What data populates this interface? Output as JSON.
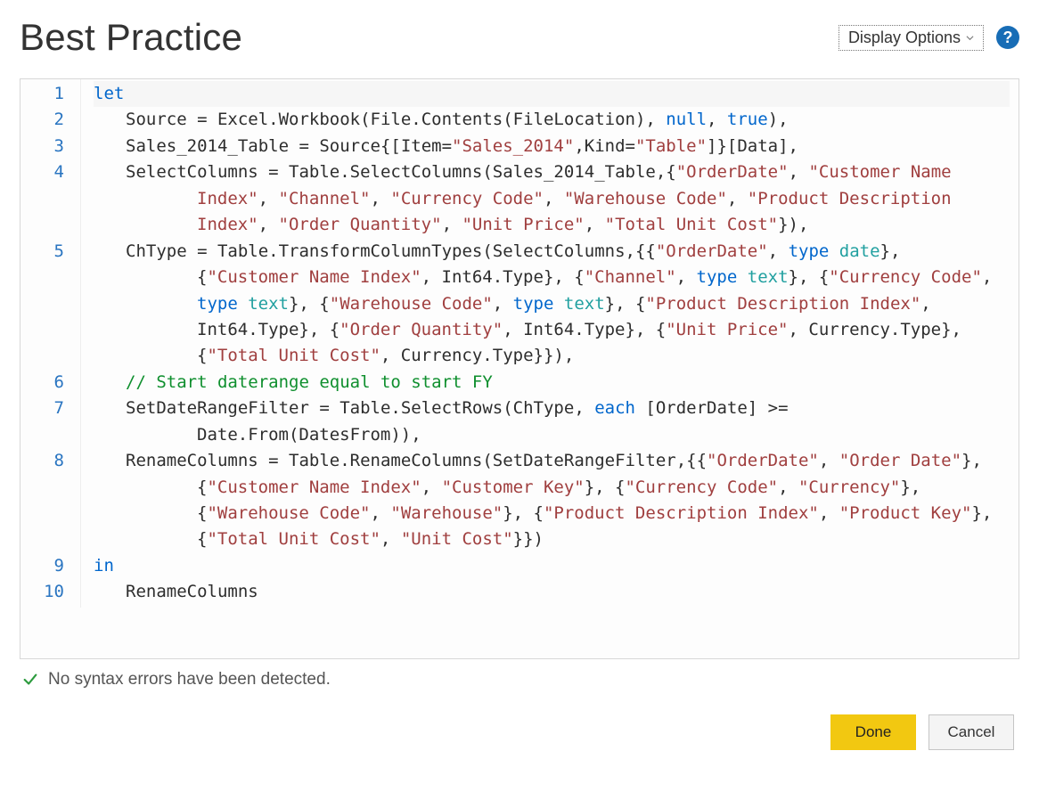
{
  "header": {
    "title": "Best Practice",
    "display_options_label": "Display Options",
    "help_tooltip": "?"
  },
  "editor": {
    "lines": [
      {
        "n": 1,
        "segments": [
          {
            "t": "let",
            "c": "kw"
          }
        ]
      },
      {
        "n": 2,
        "indent": 1,
        "segments": [
          {
            "t": "Source = Excel.Workbook(File.Contents(FileLocation), "
          },
          {
            "t": "null",
            "c": "kw"
          },
          {
            "t": ", "
          },
          {
            "t": "true",
            "c": "kw"
          },
          {
            "t": "),"
          }
        ]
      },
      {
        "n": 3,
        "indent": 1,
        "segments": [
          {
            "t": "Sales_2014_Table = Source{[Item="
          },
          {
            "t": "\"Sales_2014\"",
            "c": "str"
          },
          {
            "t": ",Kind="
          },
          {
            "t": "\"Table\"",
            "c": "str"
          },
          {
            "t": "]}[Data],"
          }
        ]
      },
      {
        "n": 4,
        "indent": 1,
        "wrap": true,
        "segments": [
          {
            "t": "SelectColumns = Table.SelectColumns(Sales_2014_Table,{"
          },
          {
            "t": "\"OrderDate\"",
            "c": "str"
          },
          {
            "t": ", "
          },
          {
            "t": "\"Customer Name Index\"",
            "c": "str"
          },
          {
            "t": ", "
          },
          {
            "t": "\"Channel\"",
            "c": "str"
          },
          {
            "t": ", "
          },
          {
            "t": "\"Currency Code\"",
            "c": "str"
          },
          {
            "t": ", "
          },
          {
            "t": "\"Warehouse Code\"",
            "c": "str"
          },
          {
            "t": ", "
          },
          {
            "t": "\"Product Description Index\"",
            "c": "str"
          },
          {
            "t": ", "
          },
          {
            "t": "\"Order Quantity\"",
            "c": "str"
          },
          {
            "t": ", "
          },
          {
            "t": "\"Unit Price\"",
            "c": "str"
          },
          {
            "t": ", "
          },
          {
            "t": "\"Total Unit Cost\"",
            "c": "str"
          },
          {
            "t": "}),"
          }
        ]
      },
      {
        "n": 5,
        "indent": 1,
        "wrap": true,
        "segments": [
          {
            "t": "ChType = Table.TransformColumnTypes(SelectColumns,{{"
          },
          {
            "t": "\"OrderDate\"",
            "c": "str"
          },
          {
            "t": ", "
          },
          {
            "t": "type",
            "c": "kw"
          },
          {
            "t": " "
          },
          {
            "t": "date",
            "c": "type"
          },
          {
            "t": "}, {"
          },
          {
            "t": "\"Customer Name Index\"",
            "c": "str"
          },
          {
            "t": ", Int64.Type}, {"
          },
          {
            "t": "\"Channel\"",
            "c": "str"
          },
          {
            "t": ", "
          },
          {
            "t": "type",
            "c": "kw"
          },
          {
            "t": " "
          },
          {
            "t": "text",
            "c": "type"
          },
          {
            "t": "}, {"
          },
          {
            "t": "\"Currency Code\"",
            "c": "str"
          },
          {
            "t": ", "
          },
          {
            "t": "type",
            "c": "kw"
          },
          {
            "t": " "
          },
          {
            "t": "text",
            "c": "type"
          },
          {
            "t": "}, {"
          },
          {
            "t": "\"Warehouse Code\"",
            "c": "str"
          },
          {
            "t": ", "
          },
          {
            "t": "type",
            "c": "kw"
          },
          {
            "t": " "
          },
          {
            "t": "text",
            "c": "type"
          },
          {
            "t": "}, {"
          },
          {
            "t": "\"Product Description Index\"",
            "c": "str"
          },
          {
            "t": ", Int64.Type}, {"
          },
          {
            "t": "\"Order Quantity\"",
            "c": "str"
          },
          {
            "t": ", Int64.Type}, {"
          },
          {
            "t": "\"Unit Price\"",
            "c": "str"
          },
          {
            "t": ", Currency.Type}, {"
          },
          {
            "t": "\"Total Unit Cost\"",
            "c": "str"
          },
          {
            "t": ", Currency.Type}}),"
          }
        ]
      },
      {
        "n": 6,
        "indent": 1,
        "segments": [
          {
            "t": "// Start daterange equal to start FY",
            "c": "cmt"
          }
        ]
      },
      {
        "n": 7,
        "indent": 1,
        "wrap": true,
        "segments": [
          {
            "t": "SetDateRangeFilter = Table.SelectRows(ChType, "
          },
          {
            "t": "each",
            "c": "kw"
          },
          {
            "t": " [OrderDate] >= Date.From(DatesFrom)),"
          }
        ]
      },
      {
        "n": 8,
        "indent": 1,
        "wrap": true,
        "segments": [
          {
            "t": "RenameColumns = Table.RenameColumns(SetDateRangeFilter,{{"
          },
          {
            "t": "\"OrderDate\"",
            "c": "str"
          },
          {
            "t": ", "
          },
          {
            "t": "\"Order Date\"",
            "c": "str"
          },
          {
            "t": "}, {"
          },
          {
            "t": "\"Customer Name Index\"",
            "c": "str"
          },
          {
            "t": ", "
          },
          {
            "t": "\"Customer Key\"",
            "c": "str"
          },
          {
            "t": "}, {"
          },
          {
            "t": "\"Currency Code\"",
            "c": "str"
          },
          {
            "t": ", "
          },
          {
            "t": "\"Currency\"",
            "c": "str"
          },
          {
            "t": "}, {"
          },
          {
            "t": "\"Warehouse Code\"",
            "c": "str"
          },
          {
            "t": ", "
          },
          {
            "t": "\"Warehouse\"",
            "c": "str"
          },
          {
            "t": "}, {"
          },
          {
            "t": "\"Product Description Index\"",
            "c": "str"
          },
          {
            "t": ", "
          },
          {
            "t": "\"Product Key\"",
            "c": "str"
          },
          {
            "t": "}, {"
          },
          {
            "t": "\"Total Unit Cost\"",
            "c": "str"
          },
          {
            "t": ", "
          },
          {
            "t": "\"Unit Cost\"",
            "c": "str"
          },
          {
            "t": "}})"
          }
        ]
      },
      {
        "n": 9,
        "segments": [
          {
            "t": "in",
            "c": "kw"
          }
        ]
      },
      {
        "n": 10,
        "indent": 1,
        "segments": [
          {
            "t": "RenameColumns"
          }
        ]
      }
    ]
  },
  "status": {
    "message": "No syntax errors have been detected."
  },
  "buttons": {
    "done": "Done",
    "cancel": "Cancel"
  }
}
